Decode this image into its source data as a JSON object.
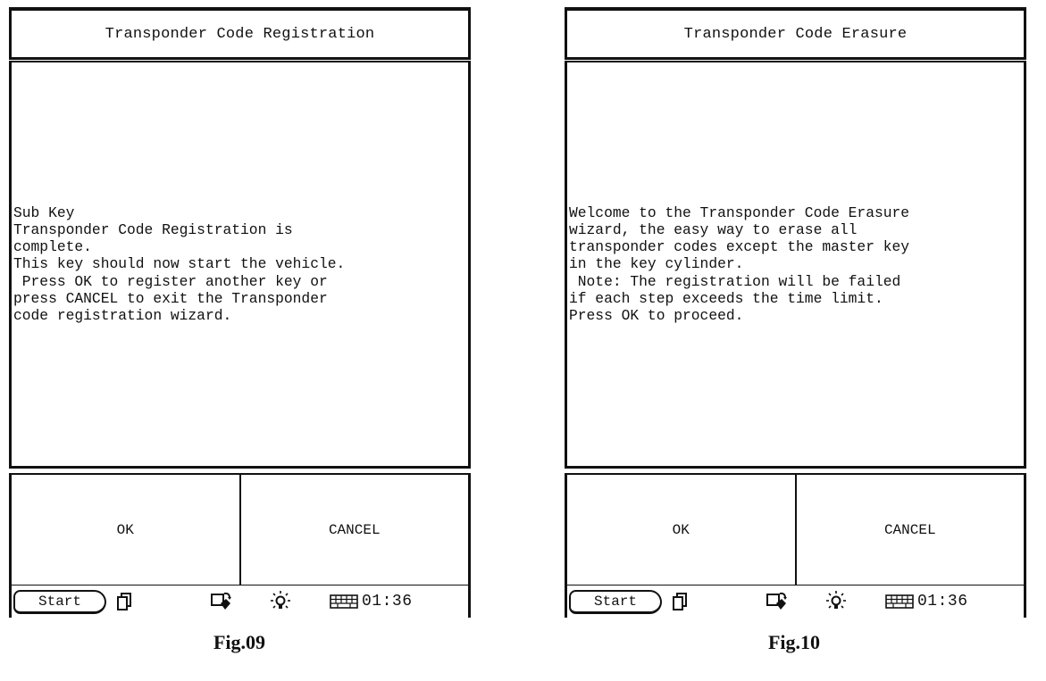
{
  "figures": [
    {
      "caption": "Fig.09",
      "title": "Transponder Code Registration",
      "message": "Sub Key\nTransponder Code Registration is\ncomplete.\nThis key should now start the vehicle.\n Press OK to register another key or\npress CANCEL to exit the Transponder\ncode registration wizard.",
      "buttons": {
        "ok": "OK",
        "cancel": "CANCEL"
      },
      "taskbar": {
        "start_label": "Start",
        "icons": [
          "windows-switch-icon",
          "connectivity-icon",
          "brightness-icon",
          "keyboard-icon"
        ],
        "clock": "01:36"
      }
    },
    {
      "caption": "Fig.10",
      "title": "Transponder Code Erasure",
      "message": "Welcome to the Transponder Code Erasure\nwizard, the easy way to erase all\ntransponder codes except the master key\nin the key cylinder.\n Note: The registration will be failed\nif each step exceeds the time limit.\nPress OK to proceed.",
      "buttons": {
        "ok": "OK",
        "cancel": "CANCEL"
      },
      "taskbar": {
        "start_label": "Start",
        "icons": [
          "windows-switch-icon",
          "connectivity-icon",
          "brightness-icon",
          "keyboard-icon"
        ],
        "clock": "01:36"
      }
    }
  ]
}
